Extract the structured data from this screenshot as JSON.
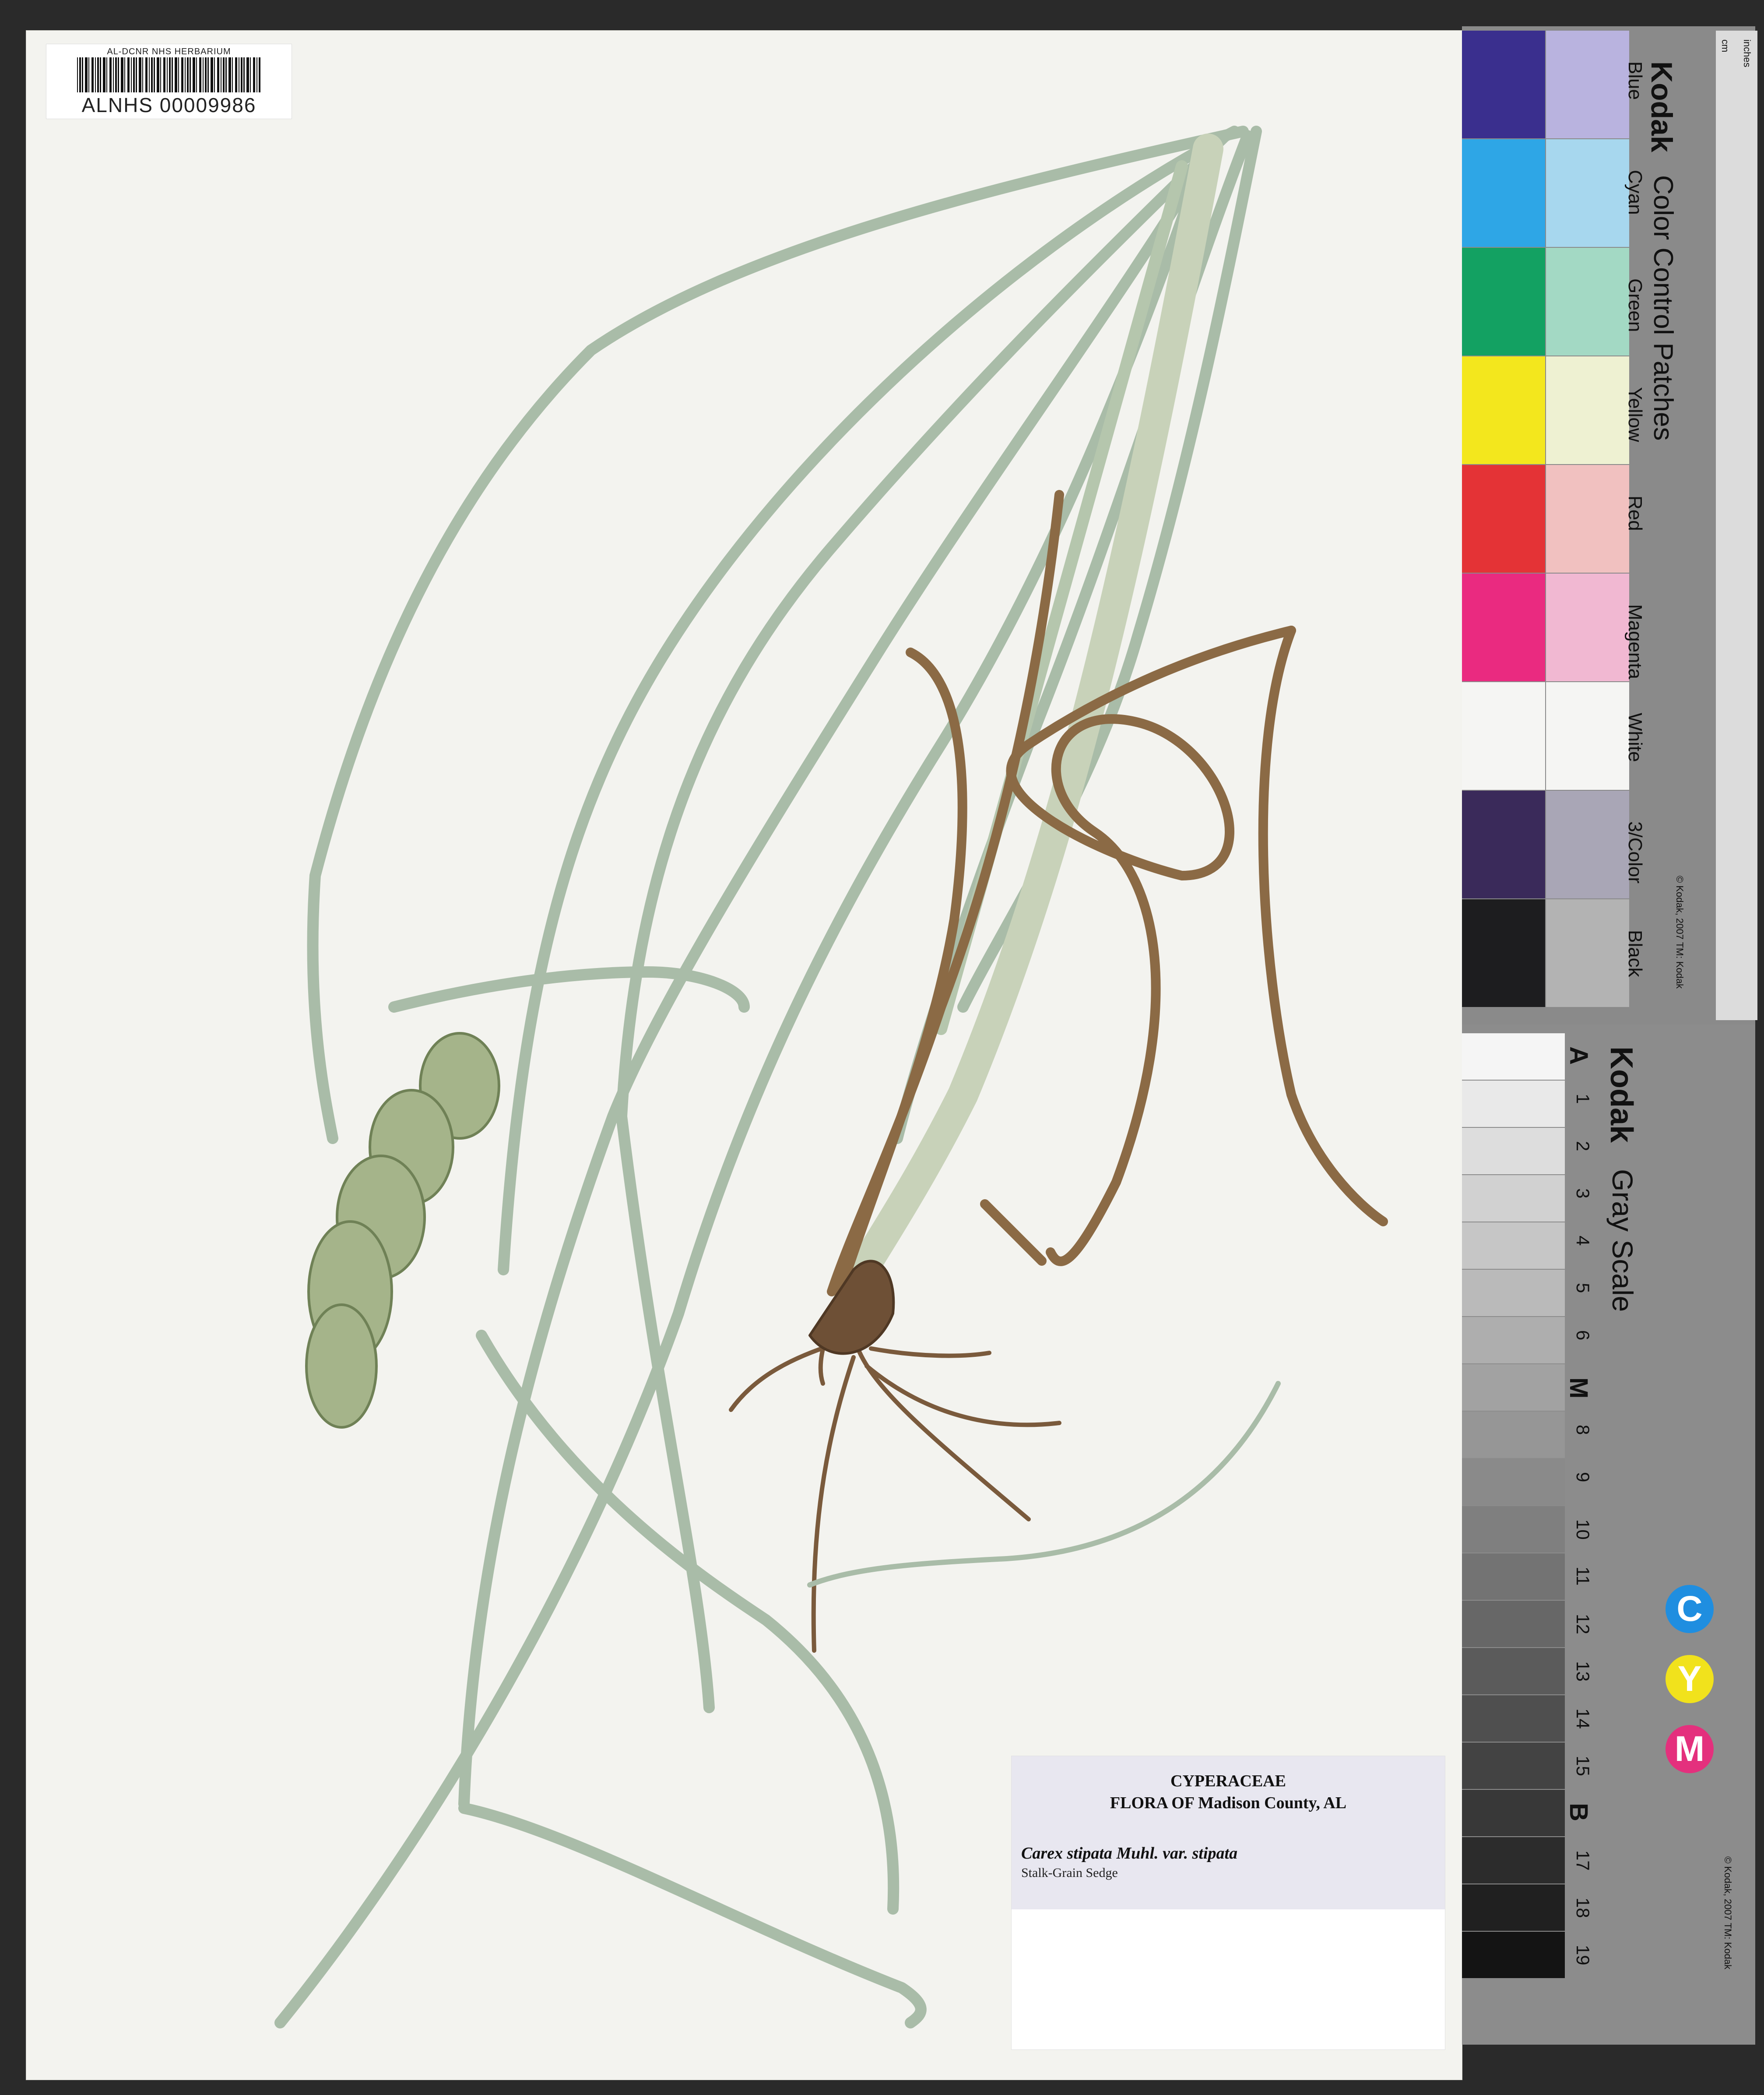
{
  "herbarium_label": {
    "institution": "AL-DCNR NHS HERBARIUM",
    "barcode_number": "ALNHS 00009986"
  },
  "determination": {
    "family": "CYPERACEAE",
    "flora": "FLORA OF Madison County, AL",
    "scientific_name": "Carex stipata Muhl. var. stipata",
    "common_name": "Stalk-Grain Sedge"
  },
  "color_card": {
    "brand": "Kodak",
    "title": "Color Control Patches",
    "patches": [
      {
        "label": "Blue",
        "color": "#3a2f8e",
        "tint": "#b9b3df"
      },
      {
        "label": "Cyan",
        "color": "#2ea6e6",
        "tint": "#a7d7ee"
      },
      {
        "label": "Green",
        "color": "#13a162",
        "tint": "#a3d9c4"
      },
      {
        "label": "Yellow",
        "color": "#f3e71d",
        "tint": "#eef1d2"
      },
      {
        "label": "Red",
        "color": "#e43336",
        "tint": "#f1c1c0"
      },
      {
        "label": "Magenta",
        "color": "#ea2a80",
        "tint": "#f1b8d2"
      },
      {
        "label": "White",
        "color": "#f5f5f3",
        "tint": "#f5f5f3"
      },
      {
        "label": "3/Color",
        "color": "#3a2a5a",
        "tint": "#a9a6b6"
      },
      {
        "label": "Black",
        "color": "#1d1d1f",
        "tint": "#b3b3b3"
      }
    ],
    "copyright": "© Kodak, 2007 TM: Kodak",
    "ruler_units": [
      "cm",
      "inches"
    ]
  },
  "gray_card": {
    "brand": "Kodak",
    "title": "Gray Scale",
    "steps": [
      "A",
      "1",
      "2",
      "3",
      "4",
      "5",
      "6",
      "M",
      "8",
      "9",
      "10",
      "11",
      "12",
      "13",
      "14",
      "15",
      "B",
      "17",
      "18",
      "19"
    ],
    "cym": [
      "C",
      "Y",
      "M"
    ],
    "cym_colors": [
      "#1f8ee0",
      "#f1e21c",
      "#e4307d"
    ],
    "copyright": "© Kodak, 2007 TM: Kodak"
  }
}
